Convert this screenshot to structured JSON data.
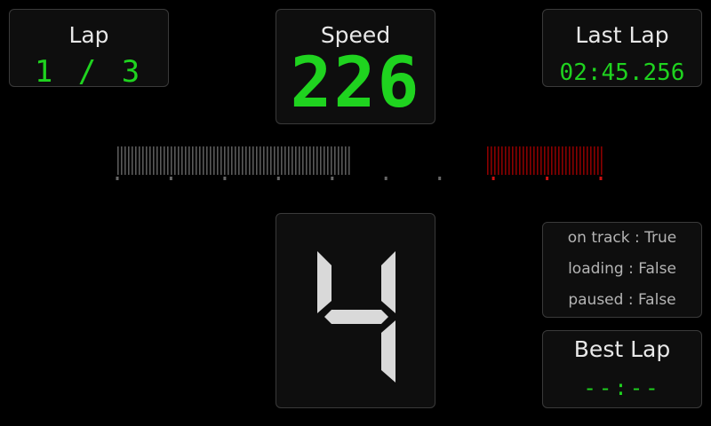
{
  "lap": {
    "title": "Lap",
    "value": "1 / 3"
  },
  "speed": {
    "title": "Speed",
    "value": "226"
  },
  "last_lap": {
    "title": "Last Lap",
    "value": "02:45.256"
  },
  "gear": {
    "value": "4"
  },
  "status": {
    "rows": [
      {
        "label": "on track",
        "value": "True"
      },
      {
        "label": "loading",
        "value": "False"
      },
      {
        "label": "paused",
        "value": "False"
      }
    ],
    "separator": " : "
  },
  "best_lap": {
    "title": "Best Lap",
    "value": "--:--"
  },
  "rpm": {
    "level": 0.48,
    "redline_start": 0.76,
    "colors": {
      "active": "#5a5a5a",
      "redline": "#8a0000",
      "tick": "#666666",
      "tick_red": "#cc1111",
      "digit_green": "#1fd31f",
      "gear_digit": "#d9d9d9"
    }
  }
}
